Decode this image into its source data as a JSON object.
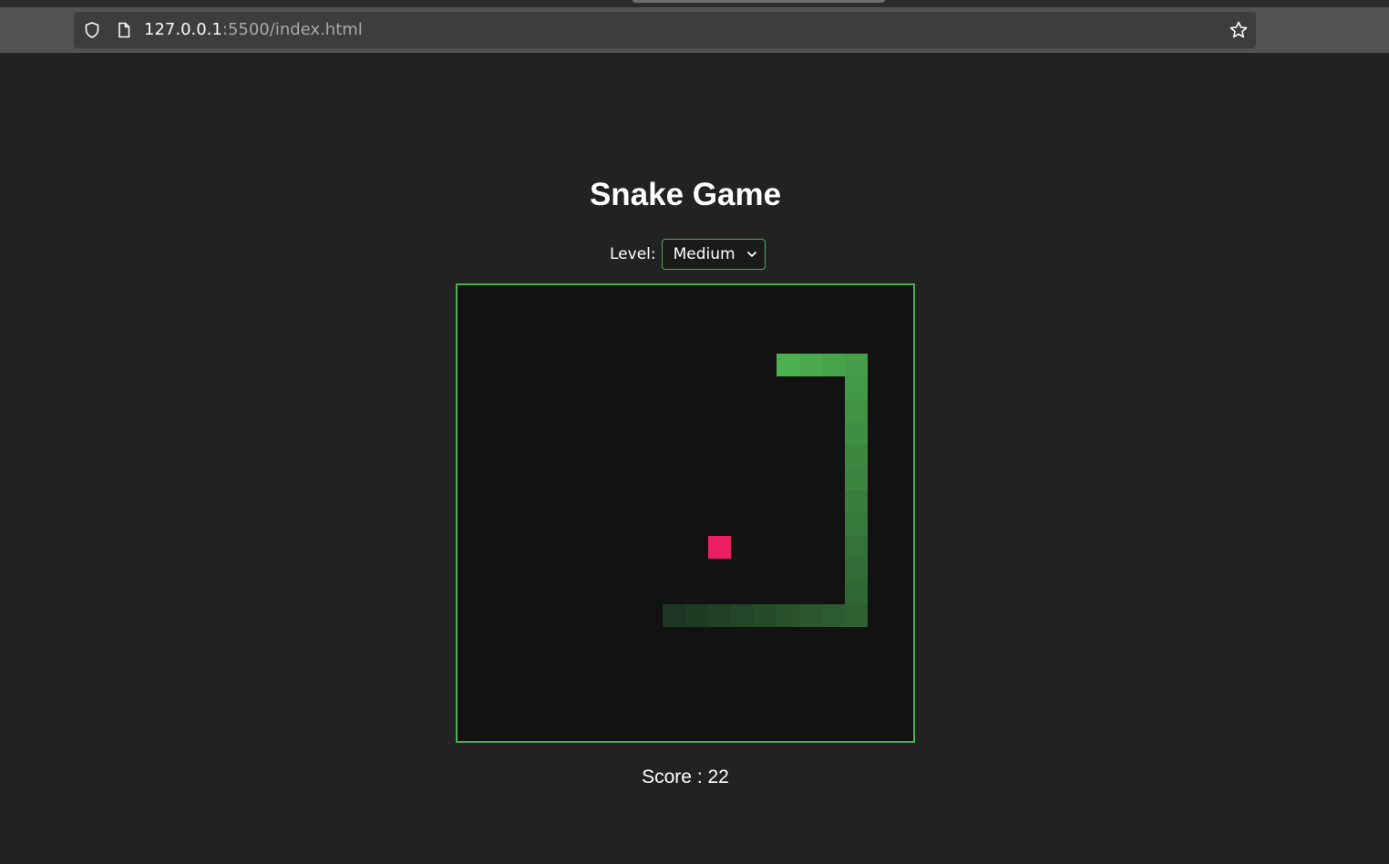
{
  "browser": {
    "url_host": "127.0.0.1",
    "url_rest": ":5500/index.html"
  },
  "game": {
    "title": "Snake Game",
    "level_label": "Level:",
    "level_selected": "Medium",
    "score_label": "Score : 22",
    "colors": {
      "border": "#4caf50",
      "board": "#121212",
      "food": "#e91e63",
      "snake_head": "#4caf50",
      "snake_tail": "#1e3522"
    },
    "grid": {
      "cols": 20,
      "rows": 20
    },
    "food": {
      "col": 11,
      "row": 11
    },
    "snake": [
      [
        14,
        3
      ],
      [
        15,
        3
      ],
      [
        16,
        3
      ],
      [
        17,
        3
      ],
      [
        17,
        4
      ],
      [
        17,
        5
      ],
      [
        17,
        6
      ],
      [
        17,
        7
      ],
      [
        17,
        8
      ],
      [
        17,
        9
      ],
      [
        17,
        10
      ],
      [
        17,
        11
      ],
      [
        17,
        12
      ],
      [
        17,
        13
      ],
      [
        17,
        14
      ],
      [
        16,
        14
      ],
      [
        15,
        14
      ],
      [
        14,
        14
      ],
      [
        13,
        14
      ],
      [
        12,
        14
      ],
      [
        11,
        14
      ],
      [
        10,
        14
      ],
      [
        9,
        14
      ]
    ]
  }
}
